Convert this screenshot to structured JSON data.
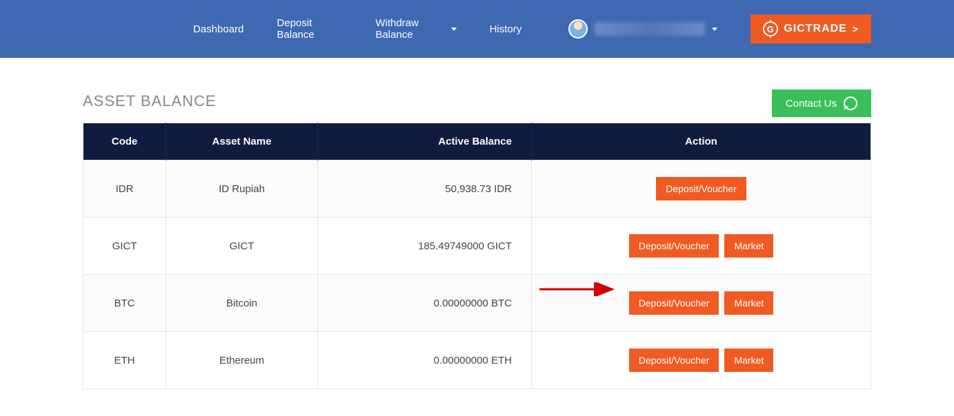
{
  "nav": {
    "dashboard": "Dashboard",
    "deposit": "Deposit Balance",
    "withdraw": "Withdraw Balance",
    "history": "History"
  },
  "brand": {
    "label": "GICTRADE",
    "chevron": ">"
  },
  "page": {
    "title": "ASSET BALANCE"
  },
  "contact": {
    "label": "Contact Us"
  },
  "table": {
    "headers": {
      "code": "Code",
      "name": "Asset Name",
      "balance": "Active Balance",
      "action": "Action"
    },
    "rows": [
      {
        "code": "IDR",
        "name": "ID Rupiah",
        "balance": "50,938.73 IDR",
        "has_market": false
      },
      {
        "code": "GICT",
        "name": "GICT",
        "balance": "185.49749000 GICT",
        "has_market": true
      },
      {
        "code": "BTC",
        "name": "Bitcoin",
        "balance": "0.00000000 BTC",
        "has_market": true
      },
      {
        "code": "ETH",
        "name": "Ethereum",
        "balance": "0.00000000 ETH",
        "has_market": true
      }
    ],
    "buttons": {
      "deposit": "Deposit/Voucher",
      "market": "Market"
    }
  }
}
